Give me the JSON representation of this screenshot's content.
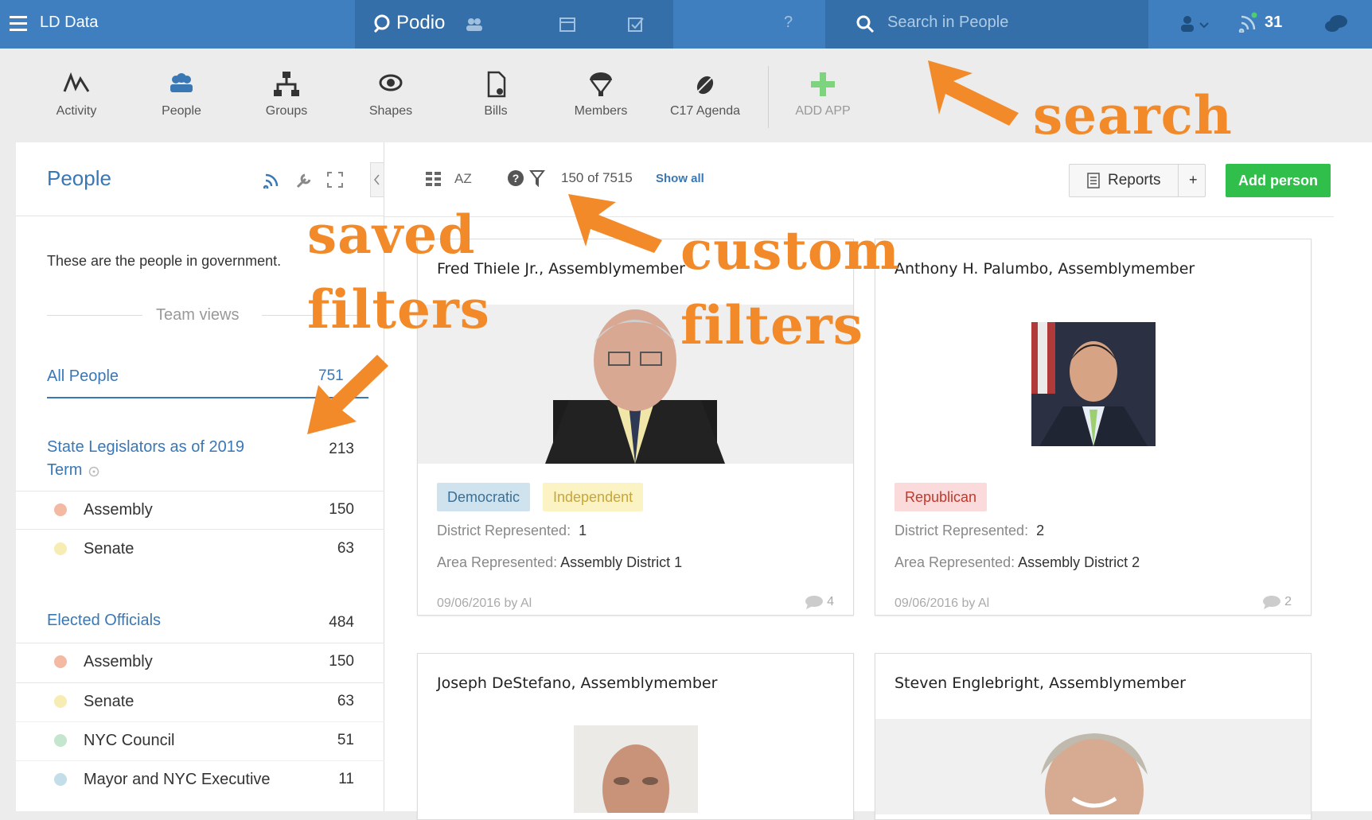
{
  "topbar": {
    "workspace": "LD Data",
    "brand": "Podio",
    "help": "?",
    "search_placeholder": "Search in People",
    "notifications_count": "31",
    "colors": {
      "bar": "#3f7fbf",
      "active": "#356fa9"
    }
  },
  "apps": [
    {
      "label": "Activity",
      "icon": "activity-icon"
    },
    {
      "label": "People",
      "icon": "people-icon"
    },
    {
      "label": "Groups",
      "icon": "groups-icon"
    },
    {
      "label": "Shapes",
      "icon": "shapes-icon"
    },
    {
      "label": "Bills",
      "icon": "bills-icon"
    },
    {
      "label": "Members",
      "icon": "members-icon"
    },
    {
      "label": "C17 Agenda",
      "icon": "agenda-icon"
    },
    {
      "label": "ADD APP",
      "icon": "plus-icon"
    }
  ],
  "sidebar": {
    "title": "People",
    "description": "These are the people in government.",
    "team_views_label": "Team views",
    "all_people": {
      "label": "All People",
      "count": "751"
    },
    "groups": [
      {
        "label": "State Legislators as of 2019",
        "label2": "Term",
        "count": "213",
        "items": [
          {
            "label": "Assembly",
            "count": "150",
            "color": "#f4b9a3"
          },
          {
            "label": "Senate",
            "count": "63",
            "color": "#f7ecb4"
          }
        ]
      },
      {
        "label": "Elected Officials",
        "count": "484",
        "items": [
          {
            "label": "Assembly",
            "count": "150",
            "color": "#f4b9a3"
          },
          {
            "label": "Senate",
            "count": "63",
            "color": "#f7ecb4"
          },
          {
            "label": "NYC Council",
            "count": "51",
            "color": "#c4e6cf"
          },
          {
            "label": "Mayor and NYC Executive",
            "count": "11",
            "color": "#c3dde9"
          }
        ]
      }
    ]
  },
  "toolbar": {
    "sort_label": "AZ",
    "filter_count": "150 of 7515",
    "show_all": "Show all",
    "reports": "Reports",
    "plus": "+",
    "add_person": "Add person",
    "colors": {
      "add": "#2fbf4a"
    }
  },
  "cards": [
    {
      "name": "Fred Thiele Jr., Assemblymember",
      "tags": [
        {
          "label": "Democratic",
          "bg": "#cfe3ee",
          "fg": "#3a6f96"
        },
        {
          "label": "Independent",
          "bg": "#fbf3c3",
          "fg": "#c6a63d"
        }
      ],
      "district_label": "District Represented:",
      "district_value": "1",
      "area_label": "Area Represented:",
      "area_value": "Assembly District 1",
      "meta": "09/06/2016 by Al",
      "comments": "4"
    },
    {
      "name": "Anthony H. Palumbo, Assemblymember",
      "tags": [
        {
          "label": "Republican",
          "bg": "#fadadb",
          "fg": "#c0392b"
        }
      ],
      "district_label": "District Represented:",
      "district_value": "2",
      "area_label": "Area Represented:",
      "area_value": "Assembly District 2",
      "meta": "09/06/2016 by Al",
      "comments": "2"
    },
    {
      "name": "Joseph DeStefano, Assemblymember"
    },
    {
      "name": "Steven Englebright, Assemblymember"
    }
  ],
  "annotations": {
    "search": "search",
    "saved_1": "saved",
    "saved_2": "filters",
    "custom_1": "custom",
    "custom_2": "filters"
  }
}
